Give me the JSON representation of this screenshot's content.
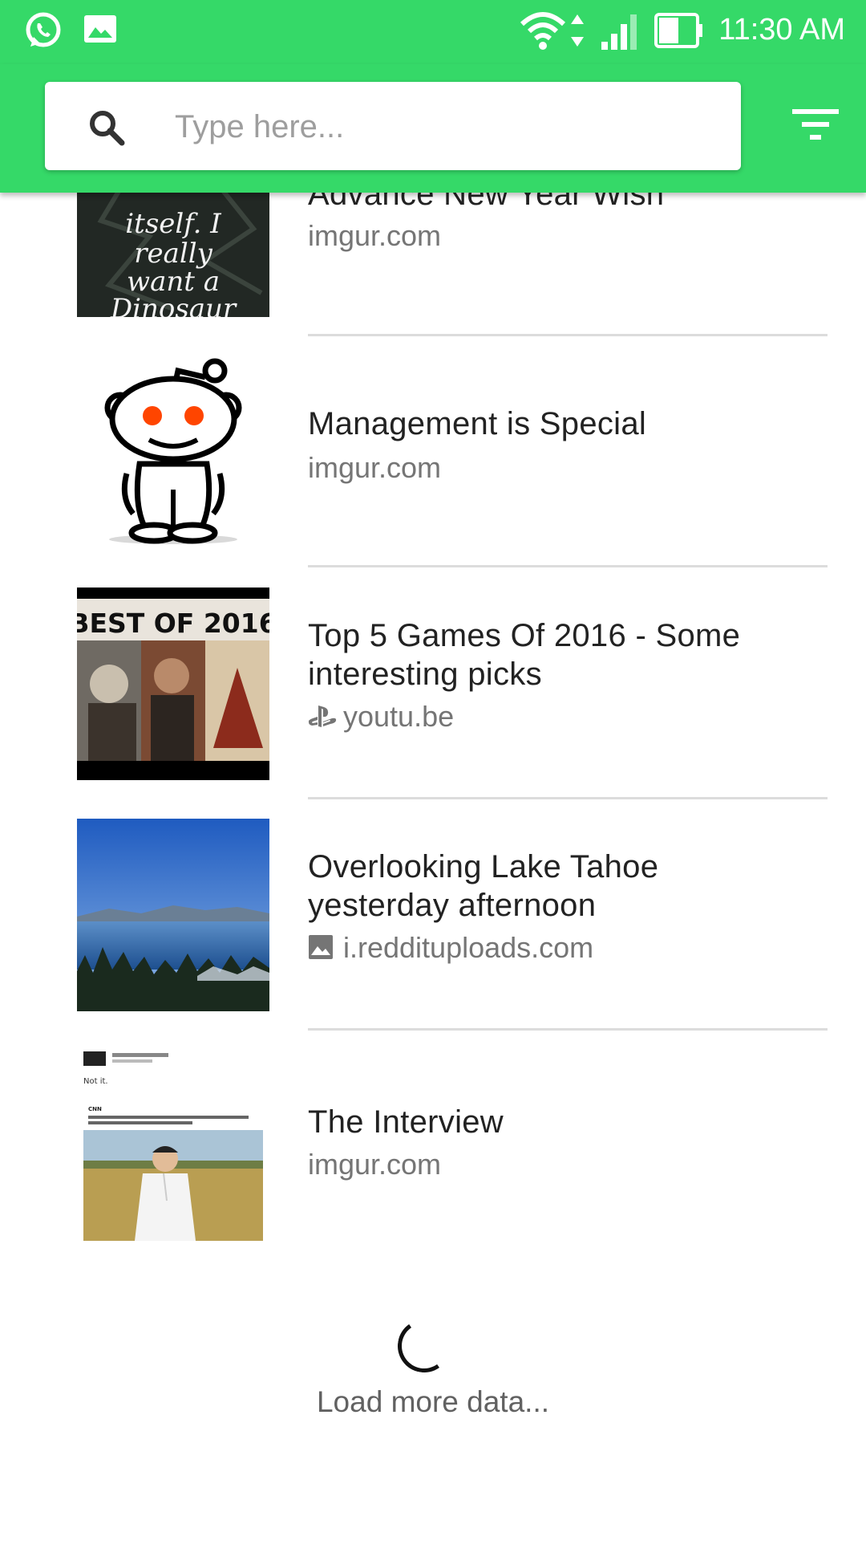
{
  "status_bar": {
    "time": "11:30 AM",
    "icons": [
      "whatsapp-icon",
      "image-icon",
      "wifi-icon",
      "data-arrows-icon",
      "signal-icon",
      "battery-icon"
    ]
  },
  "search": {
    "placeholder": "Type here..."
  },
  "toolbar": {
    "filter_icon": "filter-icon",
    "search_icon": "search-icon"
  },
  "posts": [
    {
      "title": "Advance New Year Wish",
      "source": "imgur.com",
      "thumb_text": [
        "itself. I",
        "really",
        "want a",
        "Dinosaur"
      ]
    },
    {
      "title": "Management is Special",
      "source": "imgur.com"
    },
    {
      "title": "Top 5 Games Of 2016 - Some interesting picks",
      "source": "youtu.be",
      "source_icon": "playstation-icon",
      "thumb_text": "BEST OF 2016"
    },
    {
      "title": "Overlooking Lake Tahoe yesterday afternoon",
      "source": "i.reddituploads.com",
      "source_icon": "image-icon"
    },
    {
      "title": "The Interview",
      "source": "imgur.com",
      "thumb_text": [
        "Not it.",
        "CNN",
        "South Korea says it has a plan to assassinate Kim Jong Un cnn.it/2dmPl9m"
      ]
    }
  ],
  "footer": {
    "load_more": "Load more data..."
  },
  "colors": {
    "primary": "#35d968",
    "text": "#222222",
    "secondary_text": "#757575",
    "divider": "#dcdcdc"
  }
}
